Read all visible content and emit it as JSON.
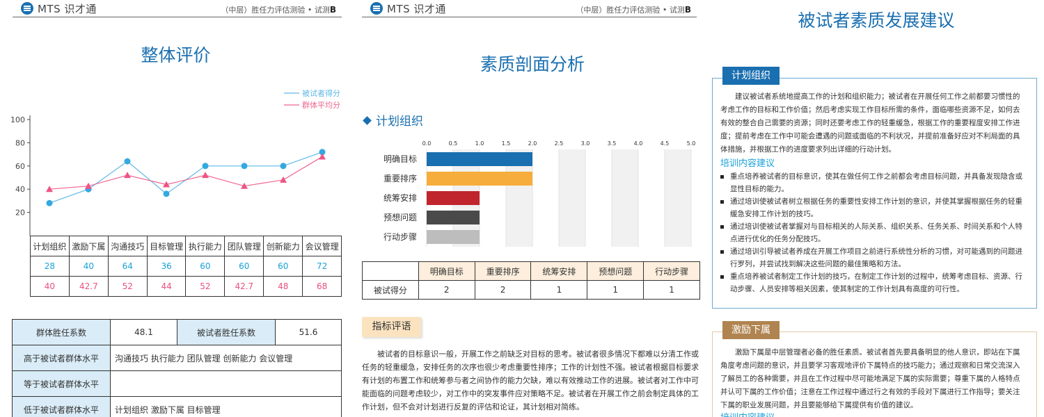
{
  "pages": [
    {
      "header": {
        "logo": "MTS 识才通",
        "subtitle": "（中层）胜任力评估测验 • 试测",
        "version": "B"
      },
      "title": "整体评价",
      "legend": [
        "被试者得分",
        "群体平均分"
      ],
      "score_rows": [
        [
          "计划组织",
          "激励下属",
          "沟通技巧",
          "目标管理",
          "执行能力",
          "团队管理",
          "创新能力",
          "会议管理"
        ],
        [
          "28",
          "40",
          "64",
          "36",
          "60",
          "60",
          "60",
          "72"
        ],
        [
          "40",
          "42.7",
          "52",
          "44",
          "52",
          "42.7",
          "48",
          "68"
        ]
      ],
      "summary": {
        "group_coef_label": "群体胜任系数",
        "group_coef_value": "48.1",
        "subject_coef_label": "被试者胜任系数",
        "subject_coef_value": "51.6",
        "higher_label": "高于被试者群体水平",
        "higher_value": "沟通技巧 执行能力 团队管理 创新能力 会议管理",
        "equal_label": "等于被试者群体水平",
        "equal_value": "",
        "lower_label": "低于被试者群体水平",
        "lower_value": "计划组织 激励下属 目标管理"
      }
    },
    {
      "header": {
        "logo": "MTS 识才通",
        "subtitle": "（中层）胜任力评估测验 • 试测",
        "version": "B"
      },
      "title": "素质剖面分析",
      "section": "计划组织",
      "table_header": [
        "明确目标",
        "重要排序",
        "统筹安排",
        "预想问题",
        "行动步骤"
      ],
      "row_label": "被试得分",
      "row_values": [
        "2",
        "2",
        "1",
        "1",
        "1"
      ],
      "eval_tag": "指标评语",
      "eval_text": "被试者的目标意识一般，开展工作之前缺乏对目标的思考。被试者很多情况下都难以分清工作或任务的轻重缓急，安排任务的次序也很少考虑重要性排序；工作的计划性不强。被试者根据目标要求有计划的布置工作和统筹参与者之间协作的能力欠缺，难以有效推动工作的进展。被试者对工作中可能面临的问题考虑较少，对工作中的突发事件应对策略不足。被试者在开展工作之前会制定具体的工作计划，但不会对计划进行反复的评估和论证，其计划相对简练。"
    },
    {
      "title": "被试者素质发展建议",
      "box1_tag": "计划组织",
      "box1_text": "建议被试者系统地提高工作的计划和组织能力；被试者在开展任何工作之前都要习惯性的考虑工作的目标和工作价值；然后考虑实现工作目标所需的条件，面临哪些资源不足，如何去有效的整合自己需要的资源；同时还要考虑工作的轻重缓急，根据工作的重要程度安排工作进度；提前考虑在工作中可能会遭遇的问题或面临的不利状况，并提前准备好应对不利局面的具体措施，并根据工作的进度要求列出详细的行动计划。",
      "training_heading": "培训内容建议",
      "bullets": [
        "重点培养被试者的目标意识，使其在做任何工作之前都会考虑目标问题，并具备发现隐含或显性目标的能力。",
        "通过培训使被试者树立根据任务的重要性安排工作计划的意识，并使其掌握根据任务的轻重缓急安排工作计划的技巧。",
        "通过培训使被试者掌握对与目标相关的人际关系、组织关系、任务关系、时间关系和个人特点进行优化的任务分配技巧。",
        "通过培训引导被试者养成在开展工作项目之前进行系统性分析的习惯，对可能遇到的问题进行罗列，并尝试找到解决这些问题的最佳策略和方法。",
        "重点培养被试者制定工作计划的技巧，在制定工作计划的过程中，统筹考虑目标、资源、行动步骤、人员安排等相关因素，使其制定的工作计划具有高度的可行性。"
      ],
      "box2_tag": "激励下属",
      "box2_text": "激励下属是中层管理者必备的胜任素质。被试者首先要具备明显的他人意识，即站在下属角度考虑问题的意识，并且要学习客观地评价下属特点的技巧能力；通过观察和日常交流深入了解员工的各种需要，并且在工作过程中尽可能地满足下属的实际需要；尊重下属的人格特点并认可下属的工作价值；注意在工作过程中通过行之有效的手段对下属进行工作指导；要关注下属的职业发展问题，并且要能够给下属提供有价值的建议。",
      "training_heading2": "培训内容建议"
    }
  ],
  "chart_data": [
    {
      "type": "line",
      "categories": [
        "计划组织",
        "激励下属",
        "沟通技巧",
        "目标管理",
        "执行能力",
        "团队管理",
        "创新能力",
        "会议管理"
      ],
      "series": [
        {
          "name": "被试者得分",
          "values": [
            28,
            40,
            64,
            36,
            60,
            60,
            60,
            72
          ],
          "color": "#5fb8e6",
          "marker": "circle"
        },
        {
          "name": "群体平均分",
          "values": [
            40,
            42.7,
            52,
            44,
            52,
            42.7,
            48,
            68
          ],
          "color": "#f0648e",
          "marker": "triangle"
        }
      ],
      "ylim": [
        0,
        100
      ],
      "yticks": [
        "20",
        "40",
        "60",
        "80",
        "100"
      ],
      "legend_position": "top-right",
      "grid": false
    },
    {
      "type": "bar",
      "orientation": "horizontal",
      "categories": [
        "明确目标",
        "重要排序",
        "统筹安排",
        "预想问题",
        "行动步骤"
      ],
      "values": [
        2,
        2,
        1,
        1,
        1
      ],
      "colors": [
        "#1a6fb0",
        "#f6ad3b",
        "#c0252d",
        "#4a4a4a",
        "#bdbdbd"
      ],
      "xlim": [
        0,
        5
      ],
      "xticks": [
        "0.0",
        "0.5",
        "1.0",
        "1.5",
        "2.0",
        "2.5",
        "3.0",
        "3.5",
        "4.0",
        "4.5",
        "5.0"
      ],
      "alternating_bands": true
    }
  ]
}
